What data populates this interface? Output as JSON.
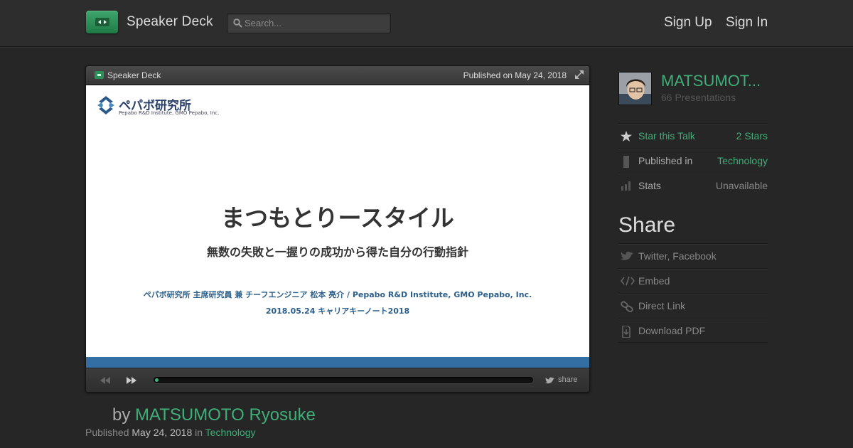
{
  "header": {
    "brand": "Speaker Deck",
    "search_placeholder": "Search...",
    "signup_label": "Sign Up",
    "signin_label": "Sign In"
  },
  "player": {
    "brand": "Speaker Deck",
    "published": "Published on May 24, 2018",
    "share_label": "share",
    "progress_fraction": 0.01
  },
  "slide": {
    "org_name": "ペパボ研究所",
    "org_sub": "Pepabo R&D Institute, GMO Pepabo, Inc.",
    "title": "まつもとりースタイル",
    "subtitle": "無数の失敗と一握りの成功から得た自分の行動指針",
    "author_line": "ペパボ研究所 主席研究員 兼 チーフエンジニア 松本 亮介 / Pepabo R&D Institute, GMO Pepabo, Inc.",
    "event_line": "2018.05.24 キャリアキーノート2018"
  },
  "byline": {
    "by": "by ",
    "author": "MATSUMOTO Ryosuke",
    "published_prefix": "Published ",
    "date": "May 24, 2018",
    "in": " in ",
    "category": "Technology"
  },
  "sidebar": {
    "user_name": "MATSUMOT...",
    "presentations": "66 Presentations",
    "star_label": "Star this Talk",
    "star_count": "2 Stars",
    "published_in_label": "Published in",
    "published_in_value": "Technology",
    "stats_label": "Stats",
    "stats_value": "Unavailable",
    "share_heading": "Share",
    "share_links": {
      "twitter": "Twitter, Facebook",
      "embed": "Embed",
      "direct": "Direct Link",
      "pdf": "Download PDF"
    }
  },
  "colors": {
    "accent": "#3fae78",
    "background": "#262626",
    "slide_bar": "#336fa3"
  }
}
